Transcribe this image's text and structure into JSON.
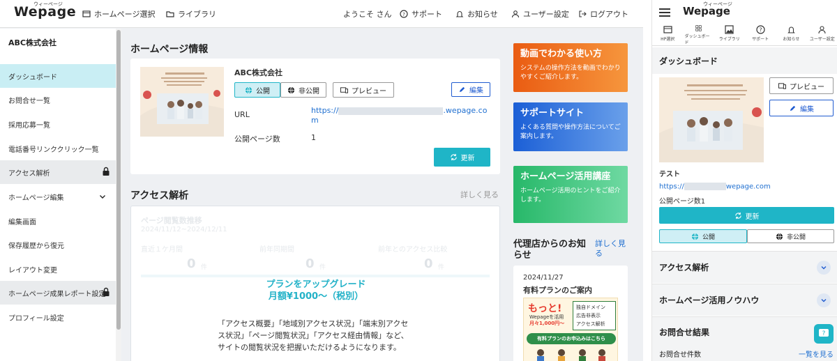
{
  "header": {
    "logo": "Wepage",
    "logo_ruby": "ウィーページ",
    "nav_homepage": "ホームページ選択",
    "nav_library": "ライブラリ",
    "welcome": "ようこそ さん",
    "support": "サポート",
    "notice": "お知らせ",
    "user_settings": "ユーザー設定",
    "logout": "ログアウト"
  },
  "sidebar": {
    "company": "ABC株式会社",
    "items": [
      {
        "label": "ダッシュボード"
      },
      {
        "label": "お問合せ一覧"
      },
      {
        "label": "採用応募一覧"
      },
      {
        "label": "電話番号リンククリック一覧"
      },
      {
        "label": "アクセス解析"
      },
      {
        "label": "ホームページ編集"
      },
      {
        "label": "編集画面"
      },
      {
        "label": "保存履歴から復元"
      },
      {
        "label": "レイアウト変更"
      },
      {
        "label": "ホームページ成果レポート設定"
      },
      {
        "label": "プロフィール設定"
      }
    ]
  },
  "homepage_info": {
    "title": "ホームページ情報",
    "site_name": "ABC株式会社",
    "public_label": "公開",
    "private_label": "非公開",
    "preview_label": "プレビュー",
    "edit_label": "編集",
    "url_label": "URL",
    "url_prefix": "https://",
    "url_suffix": ".wepage.co",
    "url_tail": "m",
    "pages_label": "公開ページ数",
    "pages_value": "1",
    "update_label": "更新"
  },
  "access": {
    "title": "アクセス解析",
    "more": "詳しく見る",
    "faded_title": "ページ閲覧数推移",
    "faded_range": "2024/11/12~2024/12/11",
    "col1": "直近１ケ月間",
    "col2": "前年同期間",
    "col3": "前年とのアクセス比較",
    "zero": "0",
    "unit": "件",
    "upgrade_line1": "プランをアップグレード",
    "upgrade_line2": "月額¥1000～（税別）",
    "desc": "「アクセス概要」「地域別アクセス状況」「端末別アクセス状況」「ページ閲覧状況」「アクセス経由情報」など、サイトの閲覧状況を把握いただけるようになります。"
  },
  "banners": [
    {
      "title": "動画でわかる使い方",
      "text": "システムの操作方法を動画でわかりやすくご紹介します。",
      "color": "#ee6f1f"
    },
    {
      "title": "サポートサイト",
      "text": "よくある質問や操作方法についてご案内します。",
      "color": "#2a6fd6"
    },
    {
      "title": "ホームページ活用講座",
      "text": "ホームページ活用のヒントをご紹介します。",
      "color": "#35c07a"
    }
  ],
  "agency": {
    "title": "代理店からのお知らせ",
    "more": "詳しく見る",
    "date": "2024/11/27",
    "headline": "有料プランのご案内",
    "promo_big": "もっと!",
    "promo_sub": "Wepageを活用",
    "promo_price": "月々1,000円～",
    "promo_bullets": [
      "独自ドメイン",
      "広告非表示",
      "アクセス解析"
    ],
    "promo_cta": "有料プランのお申込みはこちら"
  },
  "mobile": {
    "logo": "Wepage",
    "logo_ruby": "ウィーページ",
    "icons": [
      {
        "label": "HP選択",
        "icon": "browser-icon"
      },
      {
        "label": "ダッシュボード",
        "icon": "grid-icon"
      },
      {
        "label": "ライブラリ",
        "icon": "image-icon"
      },
      {
        "label": "サポート",
        "icon": "help-icon"
      },
      {
        "label": "お知らせ",
        "icon": "bell-icon"
      },
      {
        "label": "ユーザー設定",
        "icon": "user-icon"
      }
    ],
    "dashboard_title": "ダッシュボード",
    "preview_label": "プレビュー",
    "edit_label": "編集",
    "site_name": "テスト",
    "url_prefix": "https://",
    "url_suffix": "wepage.com",
    "pages": "公開ページ数1",
    "update_label": "更新",
    "public_label": "公開",
    "private_label": "非公開",
    "accordion": [
      "アクセス解析",
      "ホームページ活用ノウハウ"
    ],
    "inquiry_title": "お問合せ結果",
    "inquiry_count_label": "お問合せ件数",
    "list_link": "一覧を見る"
  },
  "colors": {
    "teal": "#1fb5c7",
    "link": "#1f6fd0",
    "active_bg": "#c9eef4"
  }
}
